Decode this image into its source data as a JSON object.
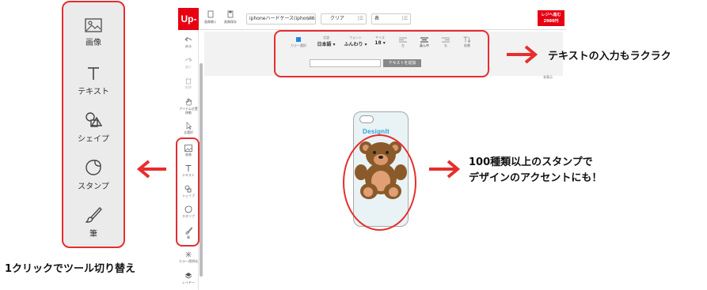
{
  "zoom_panel": {
    "items": [
      {
        "label": "画像",
        "icon": "image-icon"
      },
      {
        "label": "テキスト",
        "icon": "text-icon"
      },
      {
        "label": "シェイプ",
        "icon": "shape-icon"
      },
      {
        "label": "スタンプ",
        "icon": "stamp-icon"
      },
      {
        "label": "筆",
        "icon": "brush-icon"
      }
    ],
    "caption": "1クリックでツール切り替え"
  },
  "app": {
    "logo": "Up-T",
    "header": {
      "open_image": "画像開く",
      "save_image": "画像保存",
      "product_select": "iphoneハードケース(iphone6",
      "color_select": "クリア",
      "side_select": "表",
      "cart_line1": "レジへ進む",
      "cart_line2": "2980円"
    },
    "sidebar": [
      {
        "label": "戻る",
        "icon": "undo-icon"
      },
      {
        "label": "進む",
        "icon": "redo-icon"
      },
      {
        "label": "削除",
        "icon": "trash-icon"
      },
      {
        "label": "アイテム位置移動",
        "icon": "hand-icon"
      },
      {
        "label": "全選択",
        "icon": "cursor-icon"
      },
      {
        "label": "画像",
        "icon": "image-icon"
      },
      {
        "label": "テキスト",
        "icon": "text-icon"
      },
      {
        "label": "シェイプ",
        "icon": "shape-icon"
      },
      {
        "label": "スタンプ",
        "icon": "stamp-icon"
      },
      {
        "label": "筆",
        "icon": "brush-icon"
      },
      {
        "label": "カラー透明化",
        "icon": "transparency-icon"
      },
      {
        "label": "レイヤー",
        "icon": "layers-icon"
      }
    ],
    "text_toolbar": {
      "color_label": "カラー選択",
      "language_label": "言語",
      "language_value": "日本語",
      "font_label": "フォント",
      "font_value": "ふんわり",
      "size_label": "サイズ",
      "size_value": "18",
      "align_left": "左",
      "align_center": "真ん中",
      "align_right": "右",
      "vertical": "縦書",
      "add_button": "テキストを追加",
      "hide": "非表示",
      "accent_color": "#1e88e5"
    },
    "canvas": {
      "design_text": "DesignIt"
    }
  },
  "callouts": {
    "toolbar": "テキストの入力もラクラク",
    "stamp_line1": "100種類以上のスタンプで",
    "stamp_line2": "デザインのアクセントにも！"
  },
  "colors": {
    "brand_red": "#e60012",
    "annotation_red": "#e62e2e"
  }
}
